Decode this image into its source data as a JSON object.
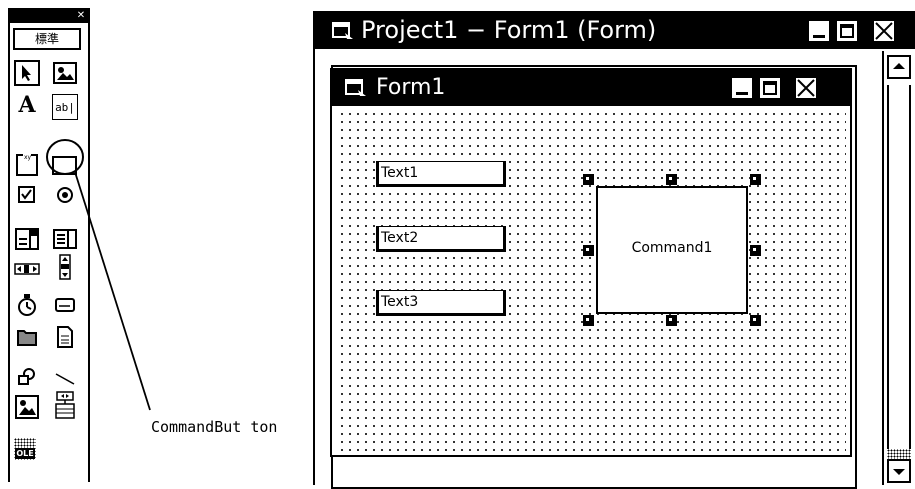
{
  "toolbox": {
    "tab_label": "標準",
    "tools": [
      {
        "name": "pointer-icon"
      },
      {
        "name": "picturebox-icon"
      },
      {
        "name": "label-icon",
        "glyph": "A"
      },
      {
        "name": "textbox-icon",
        "glyph": "ab|"
      },
      {
        "name": "frame-icon"
      },
      {
        "name": "commandbutton-icon"
      },
      {
        "name": "checkbox-icon"
      },
      {
        "name": "optionbutton-icon"
      },
      {
        "name": "combobox-icon"
      },
      {
        "name": "listbox-icon"
      },
      {
        "name": "hscrollbar-icon"
      },
      {
        "name": "vscrollbar-icon"
      },
      {
        "name": "timer-icon"
      },
      {
        "name": "drivelistbox-icon"
      },
      {
        "name": "dirlistbox-icon"
      },
      {
        "name": "filelistbox-icon"
      },
      {
        "name": "shape-icon"
      },
      {
        "name": "line-icon"
      },
      {
        "name": "image-icon"
      },
      {
        "name": "data-icon"
      },
      {
        "name": "ole-icon",
        "glyph": "OLE"
      }
    ]
  },
  "callout": {
    "label": "CommandBut ton"
  },
  "project_window": {
    "title": "Project1 − Form1 (Form)"
  },
  "form": {
    "title": "Form1",
    "textboxes": [
      "Text1",
      "Text2",
      "Text3"
    ],
    "command_button": "Command1"
  }
}
